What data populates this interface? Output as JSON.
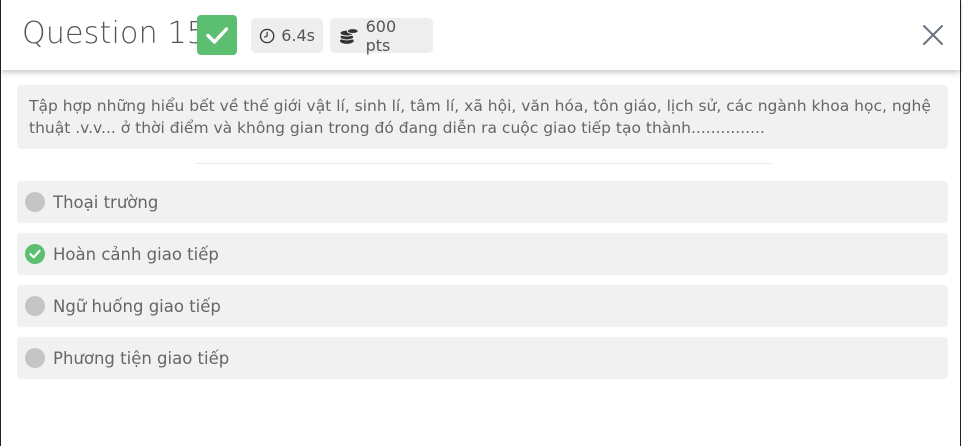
{
  "header": {
    "title": "Question 15",
    "status_icon": "check-icon",
    "time": "6.4s",
    "time_icon": "clock-icon",
    "points": "600 pts",
    "points_icon": "coins-icon",
    "close_icon": "close-icon"
  },
  "question": {
    "text": "Tập hợp những hiểu bết về thế giới vật lí, sinh lí, tâm lí, xã hội, văn hóa, tôn giáo, lịch sử, các ngành khoa học, nghệ thuật .v.v... ở thời điểm và không gian trong đó đang diễn ra cuộc giao tiếp tạo thành..............."
  },
  "options": [
    {
      "label": "Thoại trường",
      "selected": false
    },
    {
      "label": "Hoàn cảnh giao tiếp",
      "selected": true
    },
    {
      "label": "Ngữ huống giao tiếp",
      "selected": false
    },
    {
      "label": "Phương tiện giao tiếp",
      "selected": false
    }
  ],
  "colors": {
    "correct": "#5cbe70",
    "unselected": "#c5c5c5",
    "option_bg": "#f1f1f1"
  }
}
